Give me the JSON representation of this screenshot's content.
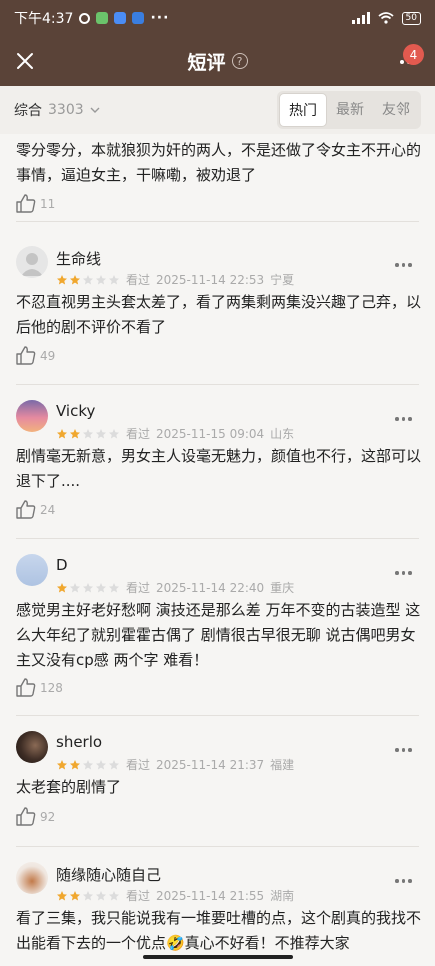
{
  "status_bar": {
    "time": "下午4:37",
    "battery": "50"
  },
  "header": {
    "title": "短评",
    "help": "?",
    "badge": "4"
  },
  "filter": {
    "sort_label": "综合",
    "count": "3303",
    "tabs": [
      "热门",
      "最新",
      "友邻"
    ]
  },
  "reviews": [
    {
      "text": "零分零分，本就狼狈为奸的两人，不是还做了令女主不开心的事情，逼迫女主，干嘛嘞，被劝退了",
      "likes": "11"
    },
    {
      "name": "生命线",
      "rating": 2,
      "watched": "看过",
      "date": "2025-11-14 22:53",
      "place": "宁夏",
      "text": "不忍直视男主头套太差了，看了两集剩两集没兴趣了己弃，以后他的剧不评价不看了",
      "likes": "49"
    },
    {
      "name": "Vicky",
      "rating": 2,
      "watched": "看过",
      "date": "2025-11-15 09:04",
      "place": "山东",
      "text": "剧情毫无新意，男女主人设毫无魅力，颜值也不行，这部可以退下了....",
      "likes": "24"
    },
    {
      "name": "D",
      "rating": 1,
      "watched": "看过",
      "date": "2025-11-14 22:40",
      "place": "重庆",
      "text": "感觉男主好老好愁啊 演技还是那么差 万年不变的古装造型 这么大年纪了就别霍霍古偶了 剧情很古早很无聊 说古偶吧男女主又没有cp感 两个字 难看！",
      "likes": "128"
    },
    {
      "name": "sherlo",
      "rating": 2,
      "watched": "看过",
      "date": "2025-11-14 21:37",
      "place": "福建",
      "text": "太老套的剧情了",
      "likes": "92"
    },
    {
      "name": "随缘随心随自己",
      "rating": 2,
      "watched": "看过",
      "date": "2025-11-14 21:55",
      "place": "湖南",
      "text": "看了三集，我只能说我有一堆要吐槽的点，这个剧真的我找不出能看下去的一个优点🤣真心不好看！不推荐大家"
    }
  ],
  "colors": {
    "header_bg": "#5a4338",
    "star_filled": "#f0a72e",
    "star_empty": "#dcdcdc",
    "badge": "#e25a4f"
  }
}
